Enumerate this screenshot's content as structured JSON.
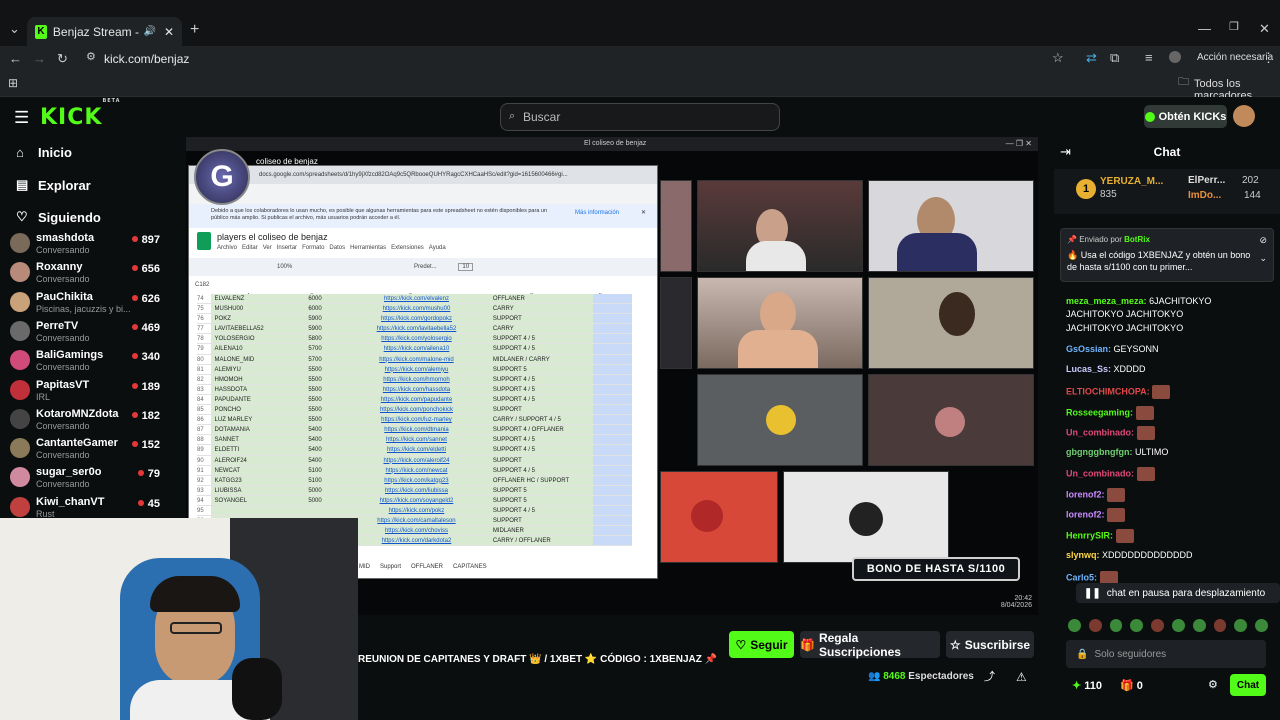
{
  "browser": {
    "tab_title": "Benjaz Stream - Watch Live",
    "url": "kick.com/benjaz",
    "accion": "Acción necesaria",
    "bookmarks": "Todos los marcadores"
  },
  "header": {
    "logo": "KICK",
    "beta": "BETA",
    "search_placeholder": "Buscar",
    "kicks_button": "Obtén KICKs"
  },
  "nav": {
    "inicio": "Inicio",
    "explorar": "Explorar",
    "siguiendo": "Siguiendo"
  },
  "channels": [
    {
      "name": "smashdota",
      "sub": "Conversando",
      "count": "897",
      "color": "#7a6a5a"
    },
    {
      "name": "Roxanny",
      "sub": "Conversando",
      "count": "656",
      "color": "#b88a7a"
    },
    {
      "name": "PauChikita",
      "sub": "Piscinas, jacuzzis y bi...",
      "count": "626",
      "color": "#c9a27a"
    },
    {
      "name": "PerreTV",
      "sub": "Conversando",
      "count": "469",
      "color": "#6a6a6a"
    },
    {
      "name": "BaliGamings",
      "sub": "Conversando",
      "count": "340",
      "color": "#d04a7a"
    },
    {
      "name": "PapitasVT",
      "sub": "IRL",
      "count": "189",
      "color": "#c0303a"
    },
    {
      "name": "KotaroMNZdota",
      "sub": "Conversando",
      "count": "182",
      "color": "#444"
    },
    {
      "name": "CantanteGamer",
      "sub": "Conversando",
      "count": "152",
      "color": "#8a7a5a"
    },
    {
      "name": "sugar_ser0o",
      "sub": "Conversando",
      "count": "79",
      "color": "#d08aa0"
    },
    {
      "name": "Kiwi_chanVT",
      "sub": "Rust",
      "count": "45",
      "color": "#c04040"
    }
  ],
  "player": {
    "window_title": "El coliseo de benjaz",
    "sheet_tab_title": "coliseo de benjaz",
    "url_bar": "docs.google.com/spreadsheets/d/1hy9jXfzcd82OAq9c5QRbooeQUHYRagcCXHCaaHSc/edit?gid=1615600466#gi...",
    "sheet_title": "players el coliseo de benjaz",
    "notice": "Debido a que los colaboradores lo usan mucho, es posible que algunas herramientas para este spreadsheet no estén disponibles para un público más amplio. Si publicas el archivo, más usuarios podrán acceder a él.",
    "notice_link": "Más información",
    "menus": [
      "Archivo",
      "Editar",
      "Ver",
      "Insertar",
      "Formato",
      "Datos",
      "Herramientas",
      "Extensiones",
      "Ayuda"
    ],
    "cell_ref": "C182",
    "zoom": "100%",
    "font": "Predet...",
    "font_size": "10",
    "columns": [
      "A",
      "B",
      "C",
      "D",
      "E"
    ],
    "sheet_tabs": [
      "MID",
      "Support",
      "OFFLANER",
      "CAPITANES"
    ],
    "bono": "BONO DE HASTA S/1100",
    "clock_time": "20:42",
    "clock_date": "8/04/2026",
    "rows": [
      {
        "n": "74",
        "name": "ELVALENZ",
        "mmr": "6000",
        "link": "https://kick.com/elvalenz",
        "role": "OFFLANER"
      },
      {
        "n": "75",
        "name": "MUSHU00",
        "mmr": "6000",
        "link": "https://kick.com/mushu00",
        "role": "CARRY"
      },
      {
        "n": "76",
        "name": "POKZ",
        "mmr": "5900",
        "link": "https://kick.com/gordopokz",
        "role": "SUPPORT"
      },
      {
        "n": "77",
        "name": "LAVITAEBELLA52",
        "mmr": "5900",
        "link": "https://kick.com/lavitaebella52",
        "role": "CARRY"
      },
      {
        "n": "78",
        "name": "YOLOSERGIO",
        "mmr": "5800",
        "link": "https://kick.com/yolosergio",
        "role": "SUPPORT 4 / 5"
      },
      {
        "n": "79",
        "name": "AILENA10",
        "mmr": "5700",
        "link": "https://kick.com/ailena10",
        "role": "SUPPORT 4 / 5"
      },
      {
        "n": "80",
        "name": "MALONE_MID",
        "mmr": "5700",
        "link": "https://kick.com/malone-mid",
        "role": "MIDLANER / CARRY"
      },
      {
        "n": "81",
        "name": "ALEMIYU",
        "mmr": "5500",
        "link": "https://kick.com/alemiyu",
        "role": "SUPPORT 5"
      },
      {
        "n": "82",
        "name": "HMOMOH",
        "mmr": "5500",
        "link": "https://kick.com/hmomoh",
        "role": "SUPPORT 4 / 5"
      },
      {
        "n": "83",
        "name": "HASSDOTA",
        "mmr": "5500",
        "link": "https://kick.com/hassdota",
        "role": "SUPPORT 4 / 5"
      },
      {
        "n": "84",
        "name": "PAPUDANTE",
        "mmr": "5500",
        "link": "https://kick.com/papudante",
        "role": "SUPPORT 4 / 5"
      },
      {
        "n": "85",
        "name": "PONCHO",
        "mmr": "5500",
        "link": "https://kick.com/ponchokick",
        "role": "SUPPORT"
      },
      {
        "n": "86",
        "name": "LUZ MARLEY",
        "mmr": "5500",
        "link": "https://kick.com/luz-marley",
        "role": "CARRY / SUPPORT 4 / 5"
      },
      {
        "n": "87",
        "name": "DOTAMANIA",
        "mmr": "5400",
        "link": "https://kick.com/dtmania",
        "role": "SUPPORT 4 / OFFLANER"
      },
      {
        "n": "88",
        "name": "SANNET",
        "mmr": "5400",
        "link": "https://kick.com/sannet",
        "role": "SUPPORT 4 / 5"
      },
      {
        "n": "89",
        "name": "ELDETTI",
        "mmr": "5400",
        "link": "https://kick.com/eldetti",
        "role": "SUPPORT 4 / 5"
      },
      {
        "n": "90",
        "name": "ALEROIF24",
        "mmr": "5400",
        "link": "https://kick.com/aleroif24",
        "role": "SUPPORT"
      },
      {
        "n": "91",
        "name": "NEWCAT",
        "mmr": "5100",
        "link": "https://kick.com/newcat",
        "role": "SUPPORT 4 / 5"
      },
      {
        "n": "92",
        "name": "KATGG23",
        "mmr": "5100",
        "link": "https://kick.com/katgg23",
        "role": "OFFLANER HC / SUPPORT"
      },
      {
        "n": "93",
        "name": "LIUBISSA",
        "mmr": "5000",
        "link": "https://kick.com/liubissa",
        "role": "SUPPORT 5"
      },
      {
        "n": "94",
        "name": "SOYANGEL",
        "mmr": "5000",
        "link": "https://kick.com/soyangeld2",
        "role": "SUPPORT 5"
      },
      {
        "n": "95",
        "name": "",
        "mmr": "",
        "link": "https://kick.com/pokz",
        "role": "SUPPORT 4 / 5"
      },
      {
        "n": "96",
        "name": "",
        "mmr": "",
        "link": "https://kick.com/camaltaleson",
        "role": "SUPPORT"
      },
      {
        "n": "97",
        "name": "",
        "mmr": "",
        "link": "https://kick.com/choviss",
        "role": "MIDLANER"
      },
      {
        "n": "98",
        "name": "",
        "mmr": "",
        "link": "https://kick.com/darkdota2",
        "role": "CARRY / OFFLANER"
      }
    ]
  },
  "stream": {
    "title": "REUNION DE CAPITANES Y DRAFT 👑 / 1XBET ⭐ CÓDIGO : 1XBENJAZ 📌",
    "seguir": "Seguir",
    "regala": "Regala Suscripciones",
    "suscribirse": "Suscribirse",
    "viewers": "8468",
    "viewers_label": "Espectadores"
  },
  "chat": {
    "title": "Chat",
    "top": [
      {
        "name": "YERUZA_M...",
        "val": "835"
      },
      {
        "name": "ElPerr...",
        "val": "202"
      },
      {
        "name": "ImDo...",
        "val": "144"
      }
    ],
    "pinned_by": "Enviado por",
    "pinned_user": "BotRix",
    "pinned_text": "🔥 Usa el código 1XBENJAZ y obtén un bono de hasta s/1100 con tu primer...",
    "messages": [
      {
        "user": "meza_meza_meza:",
        "text": "6JACHITOKYO",
        "color": "#53fc18"
      },
      {
        "user": "",
        "text": "JACHITOKYO   JACHITOKYO",
        "color": "#fff"
      },
      {
        "user": "",
        "text": "JACHITOKYO   JACHITOKYO",
        "color": "#fff"
      },
      {
        "user": "GsOssian:",
        "text": "GEYSONN",
        "color": "#6fb5ff"
      },
      {
        "user": "Lucas_Ss:",
        "text": "XDDDD",
        "color": "#c9c9ff"
      },
      {
        "user": "ELTIOCHIMCHOPA:",
        "text": "",
        "color": "#e04848"
      },
      {
        "user": "Rosseegaming:",
        "text": "",
        "color": "#53fc18"
      },
      {
        "user": "Un_combinado:",
        "text": "",
        "color": "#e04878"
      },
      {
        "user": "gbgnggbngfgn:",
        "text": "ULTIMO",
        "color": "#6fd06f"
      },
      {
        "user": "Un_combinado:",
        "text": "",
        "color": "#e04878"
      },
      {
        "user": "lorenof2:",
        "text": "",
        "color": "#c98bff"
      },
      {
        "user": "lorenof2:",
        "text": "",
        "color": "#c98bff"
      },
      {
        "user": "HenrrySIR:",
        "text": "",
        "color": "#53fc18"
      },
      {
        "user": "slynwq:",
        "text": "XDDDDDDDDDDDDD",
        "color": "#ffd84a"
      },
      {
        "user": "Carlo5:",
        "text": "",
        "color": "#6fb5ff"
      }
    ],
    "pause": "chat en pausa para desplazamiento",
    "input_placeholder": "Solo seguidores",
    "kicks": "110",
    "gifts": "0",
    "send": "Chat"
  }
}
